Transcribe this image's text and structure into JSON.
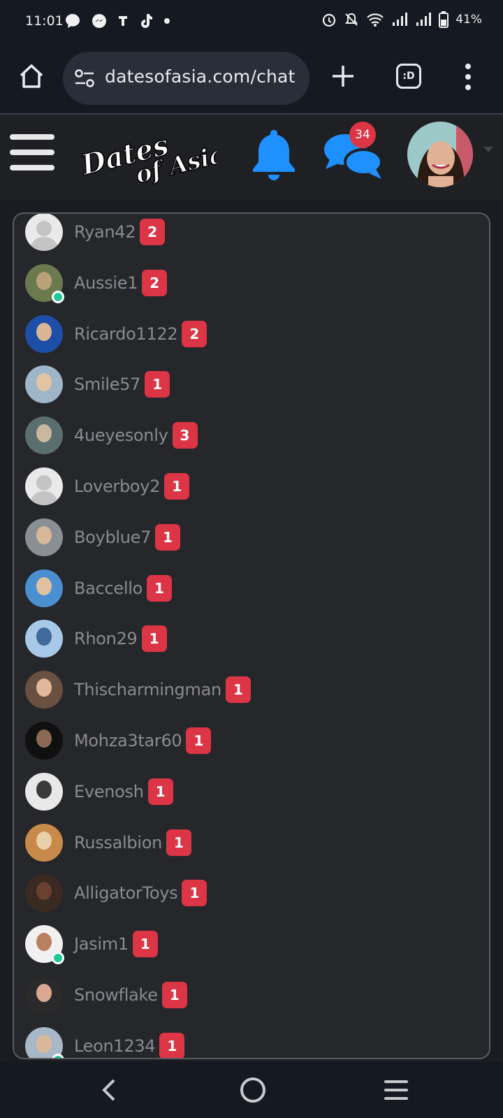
{
  "status_bar": {
    "time": "11:01",
    "battery_text": "41%"
  },
  "browser": {
    "url": "datesofasia.com/chat",
    "tabs_label": ":D"
  },
  "site_header": {
    "logo_line1": "Dates",
    "logo_line2": "of Asia",
    "chat_badge_count": "34",
    "accent_color": "#1e90ff"
  },
  "chats": [
    {
      "name": "Ryan42",
      "count": "2",
      "online": false,
      "avatar": "placeholder"
    },
    {
      "name": "Aussie1",
      "count": "2",
      "online": true,
      "avatar": "photo"
    },
    {
      "name": "Ricardo1122",
      "count": "2",
      "online": false,
      "avatar": "photo"
    },
    {
      "name": "Smile57",
      "count": "1",
      "online": false,
      "avatar": "photo"
    },
    {
      "name": "4ueyesonly",
      "count": "3",
      "online": false,
      "avatar": "photo"
    },
    {
      "name": "Loverboy2",
      "count": "1",
      "online": false,
      "avatar": "placeholder"
    },
    {
      "name": "Boyblue7",
      "count": "1",
      "online": false,
      "avatar": "photo"
    },
    {
      "name": "Baccello",
      "count": "1",
      "online": false,
      "avatar": "photo"
    },
    {
      "name": "Rhon29",
      "count": "1",
      "online": false,
      "avatar": "photo"
    },
    {
      "name": "Thischarmingman",
      "count": "1",
      "online": false,
      "avatar": "photo"
    },
    {
      "name": "Mohza3tar60",
      "count": "1",
      "online": false,
      "avatar": "photo"
    },
    {
      "name": "Evenosh",
      "count": "1",
      "online": false,
      "avatar": "photo"
    },
    {
      "name": "Russalbion",
      "count": "1",
      "online": false,
      "avatar": "photo"
    },
    {
      "name": "AlligatorToys",
      "count": "1",
      "online": false,
      "avatar": "photo"
    },
    {
      "name": "Jasim1",
      "count": "1",
      "online": true,
      "avatar": "photo"
    },
    {
      "name": "Snowflake",
      "count": "1",
      "online": false,
      "avatar": "photo"
    },
    {
      "name": "Leon1234",
      "count": "1",
      "online": true,
      "avatar": "photo"
    }
  ],
  "colors": {
    "badge": "#dc3545",
    "online": "#20c997",
    "icon_blue": "#1e90ff"
  }
}
